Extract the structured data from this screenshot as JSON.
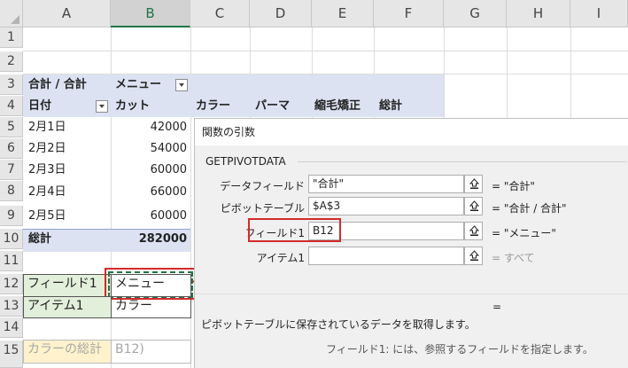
{
  "columns": [
    "A",
    "B",
    "C",
    "D",
    "E",
    "F",
    "G",
    "H",
    "I"
  ],
  "rows": [
    "1",
    "2",
    "3",
    "4",
    "5",
    "6",
    "7",
    "8",
    "9",
    "10",
    "11",
    "12",
    "13",
    "14",
    "15"
  ],
  "pivot": {
    "a3": "合計 / 合計",
    "b3": "メニュー",
    "a4": "日付",
    "b4": "カット",
    "c4": "カラー",
    "d4": "パーマ",
    "e4": "縮毛矯正",
    "f4": "総計",
    "dates": [
      "2月1日",
      "2月2日",
      "2月3日",
      "2月4日",
      "2月5日"
    ],
    "cut_values": [
      "42000",
      "54000",
      "60000",
      "66000",
      "60000"
    ],
    "total_label": "総計",
    "total_value": "282000"
  },
  "cells": {
    "a12": "フィールド1",
    "b12": "メニュー",
    "a13": "アイテム1",
    "b13": "カラー",
    "a15": "カラーの総計",
    "b15": "B12)"
  },
  "dialog": {
    "title": "関数の引数",
    "function_name": "GETPIVOTDATA",
    "args": [
      {
        "label": "データフィールド",
        "value": "\"合計\"",
        "result": "= \"合計\""
      },
      {
        "label": "ピボットテーブル",
        "value": "$A$3",
        "result": "= \"合計 / 合計\""
      },
      {
        "label": "フィールド1",
        "value": "B12",
        "result": "= \"メニュー\""
      },
      {
        "label": "アイテム1",
        "value": "",
        "result": "= すべて"
      }
    ],
    "equals": "=",
    "description": "ピボットテーブルに保存されているデータを取得します。",
    "hint": "フィールド1:   には、参照するフィールドを指定します。"
  },
  "colors": {
    "pivot_band": "#dce2f2",
    "field_cell": "#e2efda",
    "selection": "#217346",
    "callout": "#d22b2b"
  }
}
